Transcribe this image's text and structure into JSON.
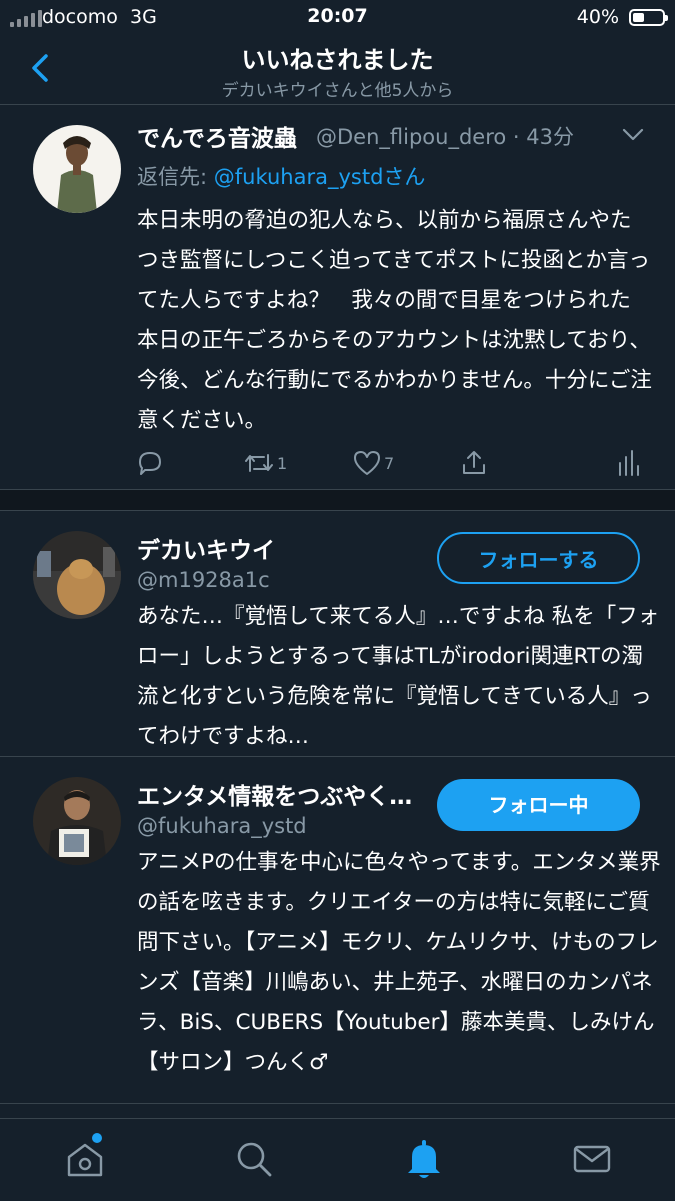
{
  "status_bar": {
    "carrier": "docomo",
    "network": "3G",
    "time": "20:07",
    "battery": "40%",
    "battery_level": 0.4
  },
  "header": {
    "title": "いいねされました",
    "subtitle": "デカいキウイさんと他5人から"
  },
  "tweet": {
    "name": "でんでろ音波蟲",
    "handle_time": "@Den_flipou_dero · 43分",
    "reply_prefix": "返信先: ",
    "reply_mention": "@fukuhara_ystdさん",
    "text": "本日未明の脅迫の犯人なら、以前から福原さんやたつき監督にしつこく迫ってきてポストに投函とか言ってた人らですよね？　我々の間で目星をつけられた本日の正午ごろからそのアカウントは沈黙しており、今後、どんな行動にでるかわかりません。十分にご注意ください。",
    "retweet_count": "1",
    "like_count": "7"
  },
  "users": [
    {
      "name": "デカいキウイ",
      "handle": "@m1928a1c",
      "button": "フォローする",
      "bio": "あなた…『覚悟して来てる人』…ですよね 私を「フォロー」しようとするって事はTLがirodori関連RTの濁流と化すという危険を常に『覚悟してきている人』ってわけですよね…"
    },
    {
      "name": "エンタメ情報をつぶやく…",
      "handle": "@fukuhara_ystd",
      "button": "フォロー中",
      "bio": "アニメPの仕事を中心に色々やってます。エンタメ業界の話を呟きます。クリエイターの方は特に気軽にご質問下さい。【アニメ】モクリ、ケムリクサ、けものフレンズ【音楽】川嶋あい、井上苑子、水曜日のカンパネラ、BiS、CUBERS【Youtuber】藤本美貴、しみけん【サロン】つんく♂"
    }
  ],
  "colors": {
    "background": "#15202b",
    "accent": "#1da1f2",
    "secondary_text": "#8899a6",
    "divider": "#38444d"
  },
  "icons": [
    "back-chevron-icon",
    "reply-icon",
    "retweet-icon",
    "like-icon",
    "share-icon",
    "analytics-icon",
    "home-icon",
    "search-icon",
    "notifications-icon",
    "messages-icon"
  ]
}
